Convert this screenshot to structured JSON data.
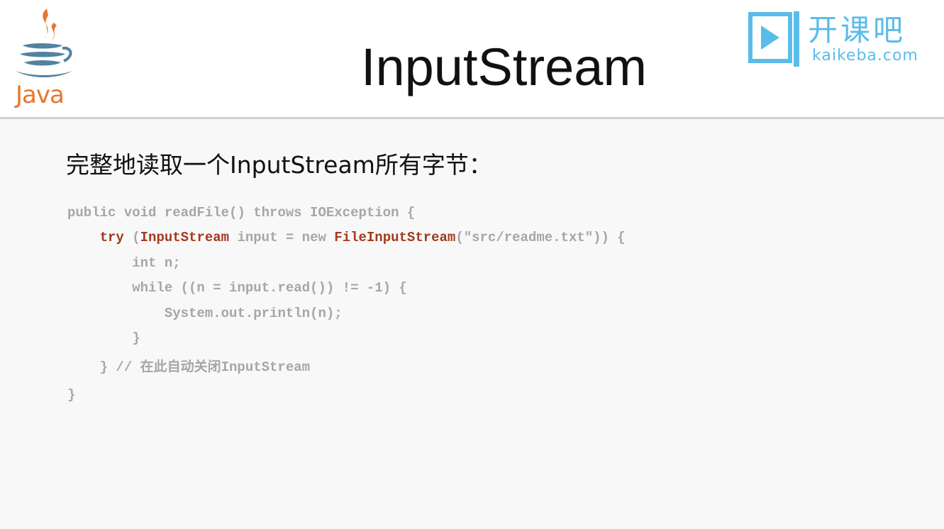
{
  "header": {
    "title": "InputStream",
    "java_logo_text": "Java",
    "brand": {
      "name_cn": "开课吧",
      "domain": "kaikeba.com"
    }
  },
  "content": {
    "subtitle": "完整地读取一个InputStream所有字节：",
    "code_lines": [
      "public void readFile() throws IOException {",
      "    try (InputStream input = new FileInputStream(\"src/readme.txt\")) {",
      "        int n;",
      "        while ((n = input.read()) != -1) {",
      "            System.out.println(n);",
      "        }",
      "    } // 在此自动关闭InputStream",
      "}"
    ],
    "tokens": {
      "try": "try",
      "open_paren": " (",
      "input_stream_type": "InputStream",
      "mid": " input = new ",
      "file_input_stream": "FileInputStream",
      "tail": "(\"src/readme.txt\")) {"
    }
  },
  "colors": {
    "background": "#f8f8f8",
    "header_bg": "#ffffff",
    "code_gray": "#a6a6a6",
    "code_keyword_red": "#a33a1e",
    "brand_blue": "#5bbcea",
    "java_orange": "#e8762b",
    "java_blue": "#5382a1"
  },
  "icons": {
    "java_logo": "java-coffee-cup-icon",
    "brand_logo": "play-screen-icon"
  }
}
